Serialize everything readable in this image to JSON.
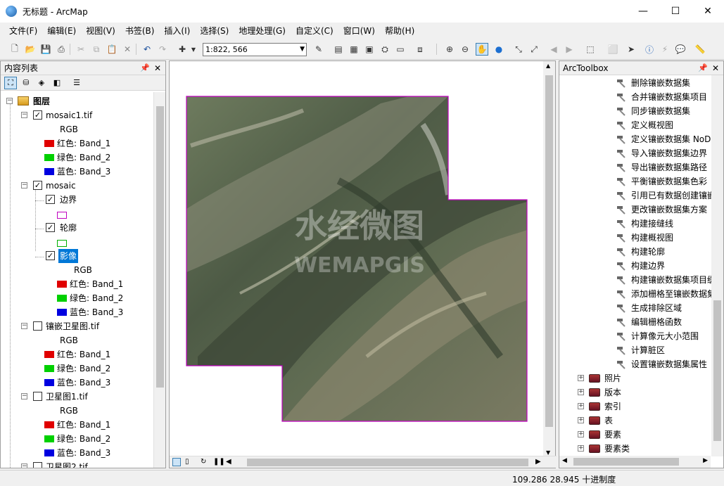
{
  "window": {
    "title": "无标题 - ArcMap",
    "minimize": "—",
    "maximize": "☐",
    "close": "✕"
  },
  "menu": [
    "文件(F)",
    "编辑(E)",
    "视图(V)",
    "书签(B)",
    "插入(I)",
    "选择(S)",
    "地理处理(G)",
    "自定义(C)",
    "窗口(W)",
    "帮助(H)"
  ],
  "toolbar": {
    "scale": "1:822, 566"
  },
  "toc": {
    "title": "内容列表",
    "root": "图层",
    "layers": [
      {
        "name": "mosaic1.tif",
        "checked": true,
        "rgb": "RGB",
        "bands": [
          "红色:    Band_1",
          "绿色: Band_2",
          "蓝色:    Band_3"
        ]
      },
      {
        "name": "mosaic",
        "checked": true,
        "children": [
          {
            "name": "边界",
            "checked": true
          },
          {
            "name": "轮廓",
            "checked": true
          },
          {
            "name": "影像",
            "checked": true,
            "rgb": "RGB",
            "bands": [
              "红色:    Band_1",
              "绿色: Band_2",
              "蓝色:    Band_3"
            ]
          }
        ]
      },
      {
        "name": "镶嵌卫星图.tif",
        "checked": false,
        "rgb": "RGB",
        "bands": [
          "红色:    Band_1",
          "绿色: Band_2",
          "蓝色:    Band_3"
        ]
      },
      {
        "name": "卫星图1.tif",
        "checked": false,
        "rgb": "RGB",
        "bands": [
          "红色:    Band_1",
          "绿色: Band_2",
          "蓝色:    Band_3"
        ]
      },
      {
        "name": "卫星图2.tif",
        "checked": false
      }
    ]
  },
  "colors": {
    "red": "#e00000",
    "green": "#00d000",
    "blue": "#0000e0",
    "boundary": "#c000c0",
    "outline": "#00b000",
    "selection": "#0078d7"
  },
  "map": {
    "watermark_main": "水经微图",
    "watermark_sub": "WEMAPGIS"
  },
  "toolbox": {
    "title": "ArcToolbox",
    "tools": [
      "删除镶嵌数据集",
      "合并镶嵌数据集项目",
      "同步镶嵌数据集",
      "定义概视图",
      "定义镶嵌数据集 NoD",
      "导入镶嵌数据集边界",
      "导出镶嵌数据集路径",
      "平衡镶嵌数据集色彩",
      "引用已有数据创建镶嵌",
      "更改镶嵌数据集方案",
      "构建接缝线",
      "构建概视图",
      "构建轮廓",
      "构建边界",
      "构建镶嵌数据集项目缓",
      "添加栅格至镶嵌数据集",
      "生成排除区域",
      "编辑栅格函数",
      "计算像元大小范围",
      "计算脏区",
      "设置镶嵌数据集属性"
    ],
    "toolsets": [
      "照片",
      "版本",
      "索引",
      "表",
      "要素",
      "要素类"
    ]
  },
  "status": {
    "coords": "109.286  28.945 十进制度"
  }
}
